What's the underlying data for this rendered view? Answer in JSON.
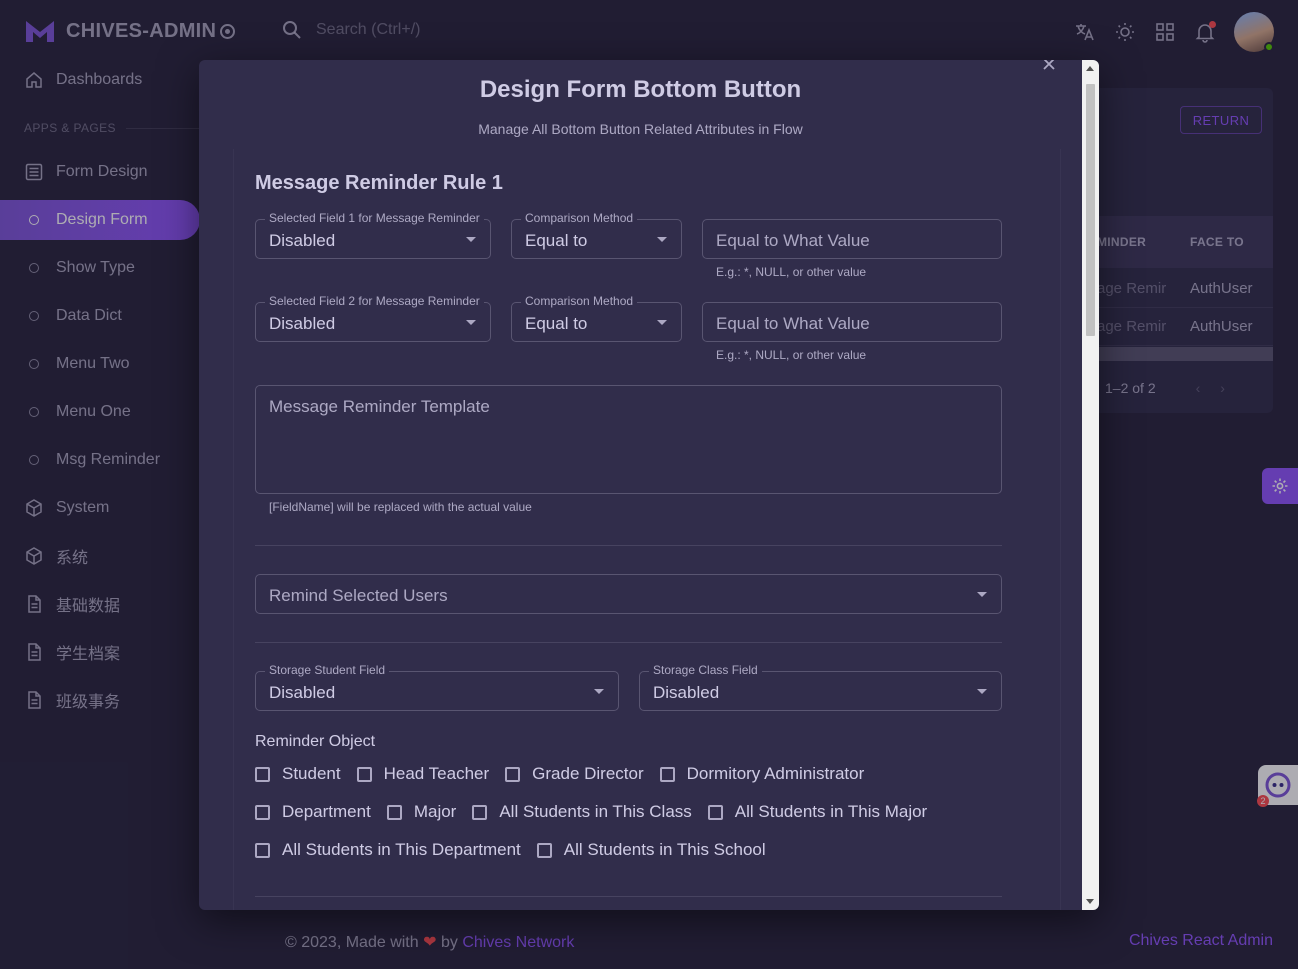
{
  "brand": {
    "name": "CHIVES-ADMIN"
  },
  "search": {
    "placeholder": "Search (Ctrl+/)"
  },
  "header_icons": [
    "translate-icon",
    "theme-icon",
    "apps-icon",
    "bell-icon"
  ],
  "sidebar": {
    "items_top": [
      {
        "label": "Dashboards",
        "icon": "home-icon"
      }
    ],
    "section": "APPS & PAGES",
    "items": [
      {
        "label": "Form Design",
        "icon": "form-icon"
      },
      {
        "label": "Design Form",
        "icon": "circle-icon",
        "active": true
      },
      {
        "label": "Show Type",
        "icon": "circle-icon"
      },
      {
        "label": "Data Dict",
        "icon": "circle-icon"
      },
      {
        "label": "Menu Two",
        "icon": "circle-icon"
      },
      {
        "label": "Menu One",
        "icon": "circle-icon"
      },
      {
        "label": "Msg Reminder",
        "icon": "circle-icon"
      },
      {
        "label": "System",
        "icon": "cube-icon"
      },
      {
        "label": "系统",
        "icon": "cube-icon"
      },
      {
        "label": "基础数据",
        "icon": "doc-icon"
      },
      {
        "label": "学生档案",
        "icon": "doc-icon"
      },
      {
        "label": "班级事务",
        "icon": "doc-icon"
      }
    ]
  },
  "background": {
    "return_label": "RETURN",
    "columns": [
      "MINDER",
      "FACE TO"
    ],
    "rows": [
      [
        "age Remir",
        "AuthUser"
      ],
      [
        "age Remir",
        "AuthUser"
      ]
    ],
    "pagination": "1–2 of 2"
  },
  "modal": {
    "title": "Design Form Bottom Button",
    "subtitle": "Manage All Bottom Button Related Attributes in Flow",
    "rule_title": "Message Reminder Rule 1",
    "field1": {
      "legend": "Selected Field 1 for Message Reminder",
      "value": "Disabled"
    },
    "compare1": {
      "legend": "Comparison Method",
      "value": "Equal to"
    },
    "equal1": {
      "placeholder": "Equal to What Value",
      "helper": "E.g.: *, NULL, or other value"
    },
    "field2": {
      "legend": "Selected Field 2 for Message Reminder",
      "value": "Disabled"
    },
    "compare2": {
      "legend": "Comparison Method",
      "value": "Equal to"
    },
    "equal2": {
      "placeholder": "Equal to What Value",
      "helper": "E.g.: *, NULL, or other value"
    },
    "template": {
      "placeholder": "Message Reminder Template",
      "helper": "[FieldName] will be replaced with the actual value"
    },
    "remind_users": {
      "placeholder": "Remind Selected Users"
    },
    "student_field": {
      "legend": "Storage Student Field",
      "value": "Disabled"
    },
    "class_field": {
      "legend": "Storage Class Field",
      "value": "Disabled"
    },
    "reminder_object": {
      "label": "Reminder Object",
      "rows": [
        [
          "Student",
          "Head Teacher",
          "Grade Director",
          "Dormitory Administrator"
        ],
        [
          "Department",
          "Major",
          "All Students in This Class",
          "All Students in This Major"
        ],
        [
          "All Students in This Department",
          "All Students in This School"
        ]
      ]
    }
  },
  "footer": {
    "copyright": "© 2023, Made with",
    "by": "by",
    "network": "Chives Network",
    "right": "Chives React Admin"
  },
  "colors": {
    "primary": "#9155fd",
    "background": "#28243d",
    "paper": "#312d4b",
    "error": "#ff4c51"
  }
}
